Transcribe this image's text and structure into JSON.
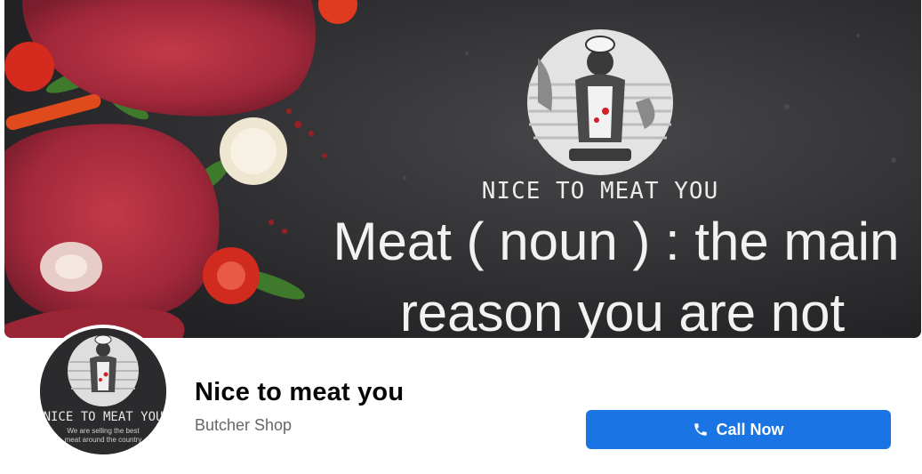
{
  "cover": {
    "logo_text": "NICE TO MEAT YOU",
    "quote_line1": "Meat ( noun ) : the main",
    "quote_line2": "reason you are not"
  },
  "profile": {
    "avatar_logo_text": "NICE TO MEAT YOU",
    "avatar_tagline1": "We are selling the best",
    "avatar_tagline2": "meat around the country",
    "name": "Nice to meat you",
    "category": "Butcher Shop"
  },
  "actions": {
    "call_label": "Call Now",
    "call_icon": "phone-icon"
  },
  "colors": {
    "button_blue": "#1b74e4",
    "chalkboard": "#2f2f31"
  }
}
